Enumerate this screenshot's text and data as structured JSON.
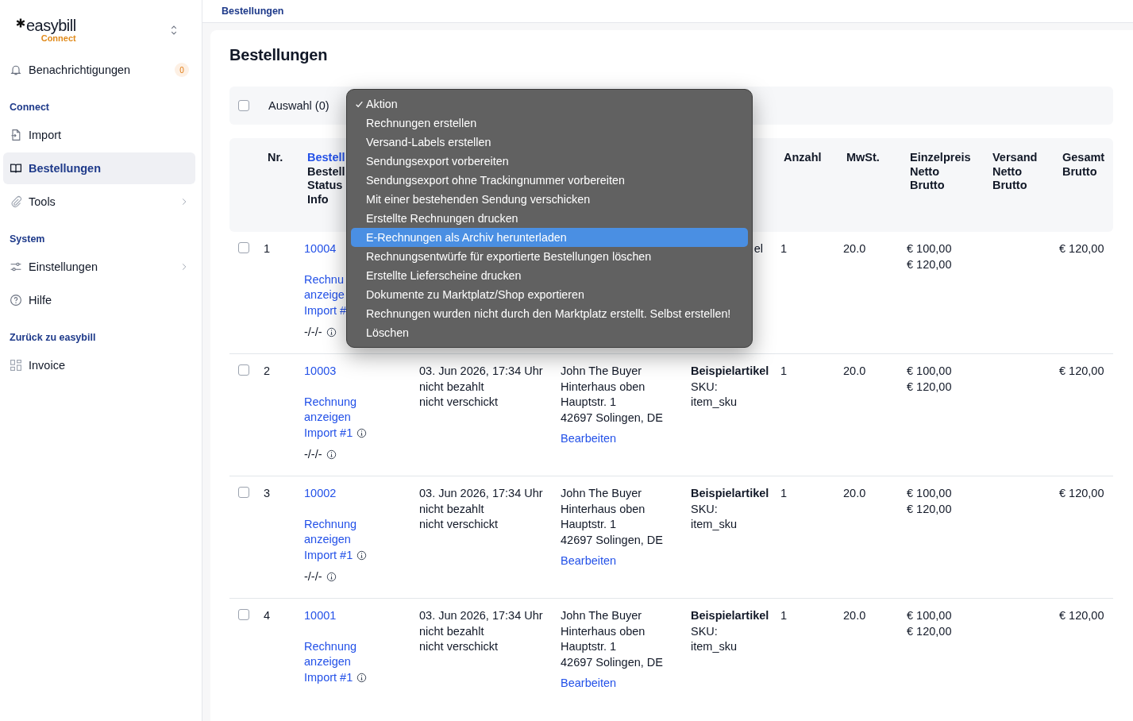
{
  "sidebar": {
    "logo": {
      "name": "easybill",
      "sub": "Connect"
    },
    "items": [
      {
        "kind": "link",
        "label": "Benachrichtigungen",
        "badge": "0",
        "selected": false,
        "has_submenu": false
      },
      {
        "kind": "section",
        "label": "Connect"
      },
      {
        "kind": "link",
        "label": "Import",
        "selected": false,
        "has_submenu": false
      },
      {
        "kind": "link",
        "label": "Bestellungen",
        "selected": true,
        "has_submenu": false
      },
      {
        "kind": "link",
        "label": "Tools",
        "selected": false,
        "has_submenu": true
      },
      {
        "kind": "section",
        "label": "System"
      },
      {
        "kind": "link",
        "label": "Einstellungen",
        "selected": false,
        "has_submenu": true
      },
      {
        "kind": "link",
        "label": "Hilfe",
        "selected": false,
        "has_submenu": false
      },
      {
        "kind": "section",
        "label": "Zurück zu easybill"
      },
      {
        "kind": "link",
        "label": "Invoice",
        "selected": false,
        "has_submenu": false
      }
    ]
  },
  "breadcrumb": "Bestellungen",
  "page_title": "Bestellungen",
  "toolbar": {
    "select_all_checked": false,
    "selection_label": "Auswahl (0)"
  },
  "action_menu": [
    {
      "label": "Aktion",
      "checked": true,
      "selected": false
    },
    {
      "label": "Rechnungen erstellen",
      "checked": false,
      "selected": false
    },
    {
      "label": "Versand-Labels erstellen",
      "checked": false,
      "selected": false
    },
    {
      "label": "Sendungsexport vorbereiten",
      "checked": false,
      "selected": false
    },
    {
      "label": "Sendungsexport ohne Trackingnummer vorbereiten",
      "checked": false,
      "selected": false
    },
    {
      "label": "Mit einer bestehenden Sendung verschicken",
      "checked": false,
      "selected": false
    },
    {
      "label": "Erstellte Rechnungen drucken",
      "checked": false,
      "selected": false
    },
    {
      "label": "E-Rechnungen als Archiv herunterladen",
      "checked": false,
      "selected": true
    },
    {
      "label": "Rechnungsentwürfe für exportierte Bestellungen löschen",
      "checked": false,
      "selected": false
    },
    {
      "label": "Erstellte Lieferscheine drucken",
      "checked": false,
      "selected": false
    },
    {
      "label": "Dokumente zu Marktplatz/Shop exportieren",
      "checked": false,
      "selected": false
    },
    {
      "label": "Rechnungen wurden nicht durch den Marktplatz erstellt. Selbst erstellen!",
      "checked": false,
      "selected": false
    },
    {
      "label": "Löschen",
      "checked": false,
      "selected": false
    }
  ],
  "table": {
    "columns": [
      {
        "lines": [
          "Nr."
        ]
      },
      {
        "lines": [
          "Bestell",
          "Bestell",
          "Status",
          "Info"
        ],
        "first_is_link": true
      },
      {
        "lines": [
          "Anzahl"
        ]
      },
      {
        "lines": [
          "MwSt."
        ]
      },
      {
        "lines": [
          "Einzelpreis",
          "Netto",
          "Brutto"
        ]
      },
      {
        "lines": [
          "Versand",
          "Netto",
          "Brutto"
        ]
      },
      {
        "lines": [
          "Gesamt",
          "Brutto"
        ]
      }
    ],
    "rows": [
      {
        "checked": false,
        "nr": "1",
        "order_no": "10004",
        "invoice_link": "Rechnu anzeige",
        "import_link": "Import #",
        "import_info": false,
        "shipping": "-/-/-",
        "product_name": "el",
        "product_cut": true,
        "quantity": "1",
        "vat": "20.0",
        "unit_net": "€ 100,00",
        "unit_gross": "€ 120,00",
        "total": "€ 120,00"
      },
      {
        "checked": false,
        "nr": "2",
        "order_no": "10003",
        "invoice_link": "Rechnung anzeigen",
        "import_link": "Import #1",
        "import_info": true,
        "shipping": "-/-/-",
        "date": "03. Jun 2026, 17:34 Uhr",
        "payment": "nicht bezahlt",
        "delivery": "nicht verschickt",
        "customer": [
          "John The Buyer",
          "Hinterhaus oben",
          "Hauptstr. 1",
          "42697 Solingen, DE"
        ],
        "edit_link": "Bearbeiten",
        "product_name": "Beispielartikel",
        "product_cut": false,
        "sku_label": "SKU:",
        "sku": "item_sku",
        "quantity": "1",
        "vat": "20.0",
        "unit_net": "€ 100,00",
        "unit_gross": "€ 120,00",
        "total": "€ 120,00"
      },
      {
        "checked": false,
        "nr": "3",
        "order_no": "10002",
        "invoice_link": "Rechnung anzeigen",
        "import_link": "Import #1",
        "import_info": true,
        "shipping": "-/-/-",
        "date": "03. Jun 2026, 17:34 Uhr",
        "payment": "nicht bezahlt",
        "delivery": "nicht verschickt",
        "customer": [
          "John The Buyer",
          "Hinterhaus oben",
          "Hauptstr. 1",
          "42697 Solingen, DE"
        ],
        "edit_link": "Bearbeiten",
        "product_name": "Beispielartikel",
        "product_cut": false,
        "sku_label": "SKU:",
        "sku": "item_sku",
        "quantity": "1",
        "vat": "20.0",
        "unit_net": "€ 100,00",
        "unit_gross": "€ 120,00",
        "total": "€ 120,00"
      },
      {
        "checked": false,
        "nr": "4",
        "order_no": "10001",
        "invoice_link": "Rechnung anzeigen",
        "import_link": "Import #1",
        "import_info": true,
        "date": "03. Jun 2026, 17:34 Uhr",
        "payment": "nicht bezahlt",
        "delivery": "nicht verschickt",
        "customer": [
          "John The Buyer",
          "Hinterhaus oben",
          "Hauptstr. 1",
          "42697 Solingen, DE"
        ],
        "edit_link": "Bearbeiten",
        "product_name": "Beispielartikel",
        "product_cut": false,
        "sku_label": "SKU:",
        "sku": "item_sku",
        "quantity": "1",
        "vat": "20.0",
        "unit_net": "€ 100,00",
        "unit_gross": "€ 120,00",
        "total": "€ 120,00"
      }
    ]
  }
}
